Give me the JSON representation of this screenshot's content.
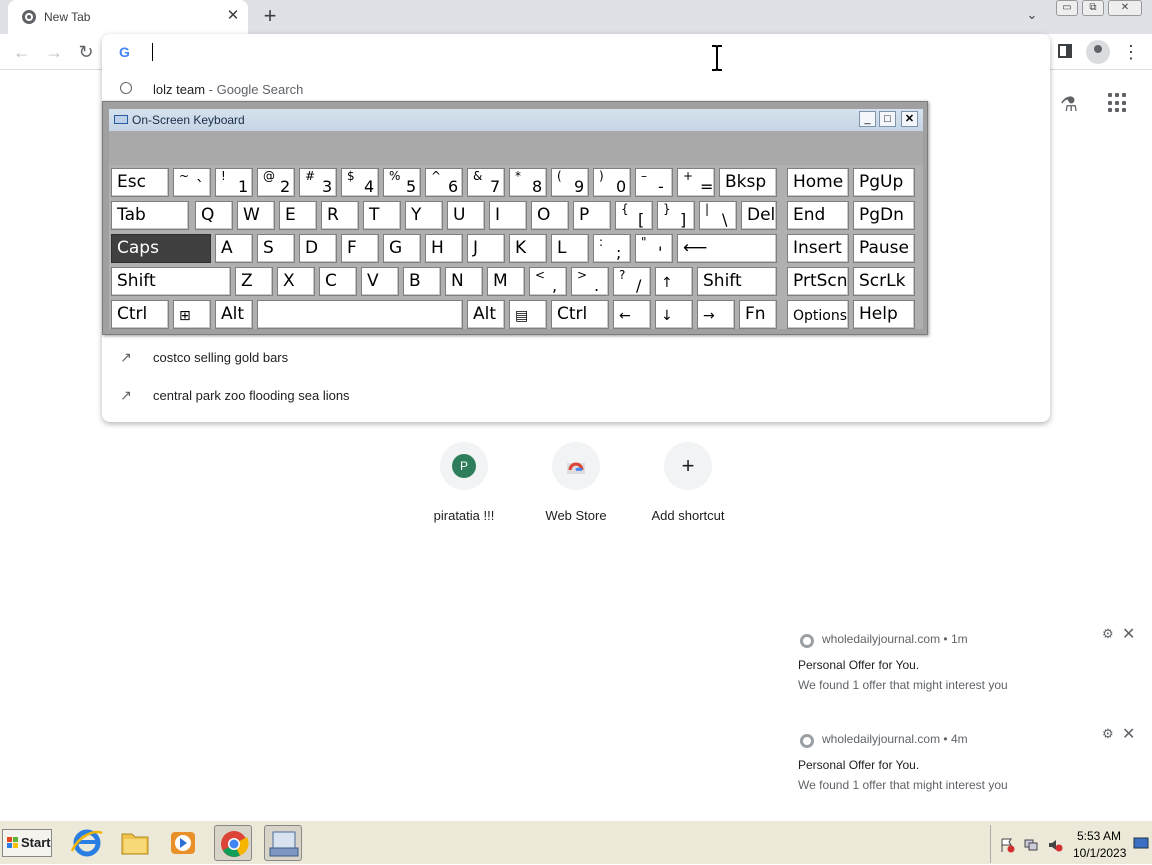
{
  "browser": {
    "tab_title": "New Tab",
    "tab_close": "✕",
    "new_tab": "+",
    "tab_search": "⌄",
    "window_minimize": "▭",
    "window_restore": "⧉",
    "window_close": "✕",
    "nav_back": "←",
    "nav_forward": "→",
    "nav_reload": "↻",
    "omnibox_value": "",
    "google_glyph": "G",
    "menu": "⋮",
    "labs": "⚗"
  },
  "omnibox": {
    "suggestions": [
      {
        "icon": "history-icon",
        "text": "lolz team",
        "separator": " - ",
        "sub": "Google Search"
      },
      {
        "icon": "trending-icon",
        "glyph": "↗",
        "text": "costco selling gold bars"
      },
      {
        "icon": "trending-icon",
        "glyph": "↗",
        "text": "central park zoo flooding sea lions"
      }
    ]
  },
  "osk": {
    "title": "On-Screen Keyboard",
    "min": "_",
    "max": "□",
    "close": "✕",
    "rows": [
      [
        {
          "n": "esc",
          "l": "Esc"
        },
        {
          "n": "tilde",
          "s": "~",
          "m": "`"
        },
        {
          "n": "1",
          "s": "!",
          "m": "1"
        },
        {
          "n": "2",
          "s": "@",
          "m": "2"
        },
        {
          "n": "3",
          "s": "#",
          "m": "3"
        },
        {
          "n": "4",
          "s": "$",
          "m": "4"
        },
        {
          "n": "5",
          "s": "%",
          "m": "5"
        },
        {
          "n": "6",
          "s": "^",
          "m": "6"
        },
        {
          "n": "7",
          "s": "&",
          "m": "7"
        },
        {
          "n": "8",
          "s": "*",
          "m": "8"
        },
        {
          "n": "9",
          "s": "(",
          "m": "9"
        },
        {
          "n": "0",
          "s": ")",
          "m": "0"
        },
        {
          "n": "minus",
          "s": "–",
          "m": "-"
        },
        {
          "n": "equals",
          "s": "+",
          "m": "="
        },
        {
          "n": "bksp",
          "l": "Bksp"
        },
        {
          "n": "home",
          "l": "Home"
        },
        {
          "n": "pgup",
          "l": "PgUp"
        }
      ],
      [
        {
          "n": "tab",
          "l": "Tab"
        },
        {
          "n": "q",
          "l": "Q"
        },
        {
          "n": "w",
          "l": "W"
        },
        {
          "n": "e",
          "l": "E"
        },
        {
          "n": "r",
          "l": "R"
        },
        {
          "n": "t",
          "l": "T"
        },
        {
          "n": "y",
          "l": "Y"
        },
        {
          "n": "u",
          "l": "U"
        },
        {
          "n": "i",
          "l": "I"
        },
        {
          "n": "o",
          "l": "O"
        },
        {
          "n": "p",
          "l": "P"
        },
        {
          "n": "lbracket",
          "s": "{",
          "m": "["
        },
        {
          "n": "rbracket",
          "s": "}",
          "m": "]"
        },
        {
          "n": "backslash",
          "s": "|",
          "m": "\\"
        },
        {
          "n": "del",
          "l": "Del"
        },
        {
          "n": "end",
          "l": "End"
        },
        {
          "n": "pgdn",
          "l": "PgDn"
        }
      ],
      [
        {
          "n": "caps",
          "l": "Caps",
          "active": true
        },
        {
          "n": "a",
          "l": "A"
        },
        {
          "n": "s",
          "l": "S"
        },
        {
          "n": "d",
          "l": "D"
        },
        {
          "n": "f",
          "l": "F"
        },
        {
          "n": "g",
          "l": "G"
        },
        {
          "n": "h",
          "l": "H"
        },
        {
          "n": "j",
          "l": "J"
        },
        {
          "n": "k",
          "l": "K"
        },
        {
          "n": "l",
          "l": "L"
        },
        {
          "n": "semicolon",
          "s": ":",
          "m": ";"
        },
        {
          "n": "quote",
          "s": "\"",
          "m": "'"
        },
        {
          "n": "enter",
          "l": "⟵"
        },
        {
          "n": "insert",
          "l": "Insert"
        },
        {
          "n": "pause",
          "l": "Pause"
        }
      ],
      [
        {
          "n": "lshift",
          "l": "Shift"
        },
        {
          "n": "z",
          "l": "Z"
        },
        {
          "n": "x",
          "l": "X"
        },
        {
          "n": "c",
          "l": "C"
        },
        {
          "n": "v",
          "l": "V"
        },
        {
          "n": "b",
          "l": "B"
        },
        {
          "n": "n",
          "l": "N"
        },
        {
          "n": "m",
          "l": "M"
        },
        {
          "n": "comma",
          "s": "<",
          "m": ","
        },
        {
          "n": "period",
          "s": ">",
          "m": "."
        },
        {
          "n": "slash",
          "s": "?",
          "m": "/"
        },
        {
          "n": "up",
          "l": "↑",
          "small": true
        },
        {
          "n": "rshift",
          "l": "Shift"
        },
        {
          "n": "prtscn",
          "l": "PrtScn"
        },
        {
          "n": "scrlk",
          "l": "ScrLk"
        }
      ],
      [
        {
          "n": "lctrl",
          "l": "Ctrl"
        },
        {
          "n": "win",
          "l": "⊞",
          "small": true
        },
        {
          "n": "lalt",
          "l": "Alt"
        },
        {
          "n": "space",
          "l": ""
        },
        {
          "n": "ralt",
          "l": "Alt"
        },
        {
          "n": "menu",
          "l": "▤",
          "small": true
        },
        {
          "n": "rctrl",
          "l": "Ctrl"
        },
        {
          "n": "left",
          "l": "←",
          "small": true
        },
        {
          "n": "down",
          "l": "↓",
          "small": true
        },
        {
          "n": "right",
          "l": "→",
          "small": true
        },
        {
          "n": "fn",
          "l": "Fn"
        },
        {
          "n": "options",
          "l": "Options",
          "small": true
        },
        {
          "n": "help",
          "l": "Help"
        }
      ]
    ]
  },
  "shortcuts": [
    {
      "name": "piratatia !!!",
      "letter": "P",
      "color": "#2e7d5b"
    },
    {
      "name": "Web Store",
      "letter": "",
      "color": "#f1f3f4"
    },
    {
      "name": "Add shortcut",
      "letter": "+",
      "color": "#f1f3f4"
    }
  ],
  "notifications": [
    {
      "source": "wholedailyjournal.com",
      "age": "1m",
      "title": "Personal Offer for You.",
      "message": "We found 1 offer that might interest you",
      "gear": "⚙",
      "close": "✕"
    },
    {
      "source": "wholedailyjournal.com",
      "age": "4m",
      "title": "Personal Offer for You.",
      "message": "We found 1 offer that might interest you",
      "gear": "⚙",
      "close": "✕"
    }
  ],
  "taskbar": {
    "start": "Start",
    "time": "5:53 AM",
    "date": "10/1/2023"
  }
}
